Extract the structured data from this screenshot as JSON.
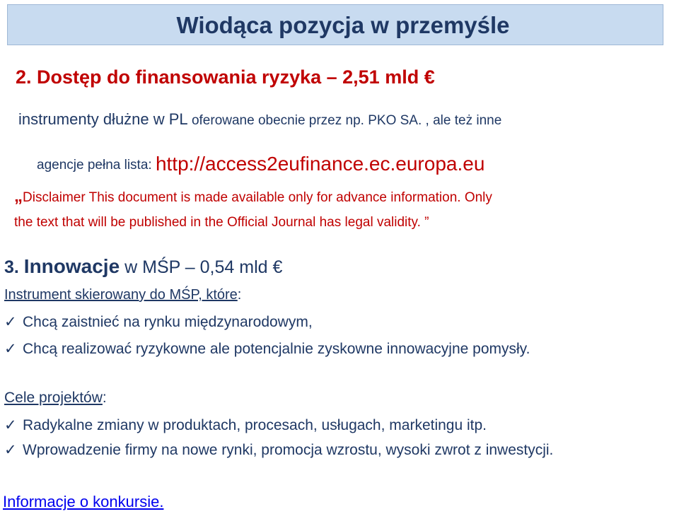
{
  "title": "Wiodąca pozycja w przemyśle",
  "section2": {
    "heading": "2. Dostęp do finansowania ryzyka – 2,51 mld",
    "currency_symbol": "€",
    "line1_a": "instrumenty dłużne w PL",
    "line1_b": " oferowane obecnie przez np. PKO SA. , ale też inne",
    "line2_a": "agencje pełna lista: ",
    "link": "http://access2eufinance.ec.europa.eu",
    "disclaimer_quote": "„",
    "disclaimer_line1": "Disclaimer This document is made available only for advance information. Only",
    "disclaimer_line2": "the text that will be published in the  Official Journal has  legal validity. ”"
  },
  "section3": {
    "heading_num": "3. ",
    "heading_word": "Innowacje",
    "heading_rest": " w MŚP – 0,54 mld",
    "currency_symbol": "€",
    "subheading": "Instrument skierowany do MŚP, które",
    "subheading_colon": ":",
    "items": [
      "Chcą zaistnieć na rynku międzynarodowym,",
      "Chcą realizować ryzykowne ale potencjalnie zyskowne innowacyjne pomysły."
    ]
  },
  "goals": {
    "heading": "Cele projektów",
    "heading_colon": ":",
    "items": [
      "Radykalne zmiany w produktach, procesach, usługach, marketingu itp.",
      "Wprowadzenie firmy na nowe rynki, promocja wzrostu, wysoki zwrot z inwestycji."
    ]
  },
  "footer_link": "Informacje o konkursie.",
  "check_glyph": "✓",
  "colors": {
    "title_bg": "#c8dbf0",
    "heading": "#c00000",
    "navy": "#1f3864",
    "link": "#0000ee"
  }
}
